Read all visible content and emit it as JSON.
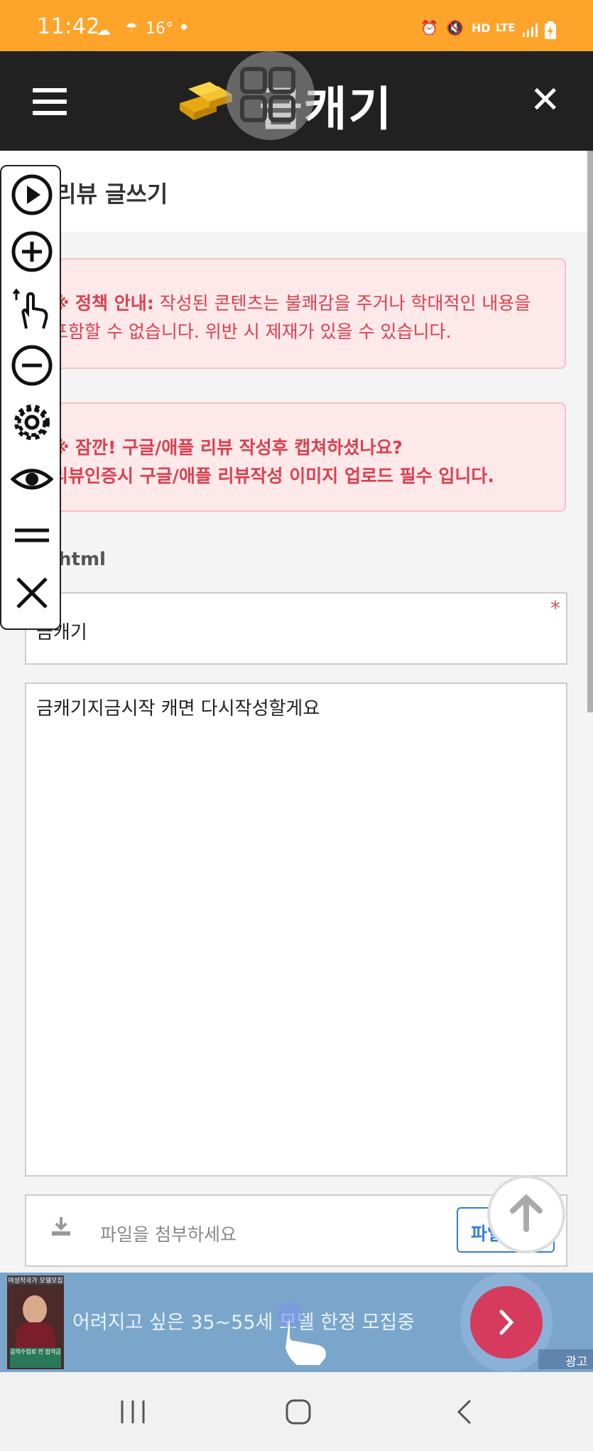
{
  "status_bar": {
    "time": "11:42",
    "temperature": "16°",
    "icons": [
      "cloud-icon",
      "weather-icon",
      "dot-icon",
      "alarm-icon",
      "mute-icon",
      "hd-voice-icon",
      "lte-icon",
      "signal-icon",
      "battery-charging-icon"
    ],
    "hd_label": "HD",
    "lte_label": "LTE"
  },
  "app_bar": {
    "menu_icon": "hamburger-icon",
    "title": "금캐기",
    "close_icon": "close-icon"
  },
  "page": {
    "back_icon": "chevron-left-icon",
    "title": "리뷰 글쓰기"
  },
  "notices": {
    "policy_prefix": "※ 정책 안내:",
    "policy_text_line1": " 작성된 콘텐츠는 불쾌감을 주거나 학대적인 내용을",
    "policy_text_line2": "포함할 수 없습니다. 위반 시 제재가 있을 수 있습니다.",
    "review_line1": "※ 잠깐! 구글/애플 리뷰 작성후 캡쳐하셨나요?",
    "review_line2": "리뷰인증시 구글/애플 리뷰작성 이미지 업로드 필수 입니다."
  },
  "form": {
    "html_checkbox_label": "html",
    "html_checked": false,
    "subject_value": "금캐기",
    "required_mark": "*",
    "content_value": "금캐기지금시작 캐면 다시작성할게요",
    "file_placeholder": "파일을 첨부하세요",
    "file_button_label": "파일"
  },
  "floating_toolbar": {
    "items": [
      "play-icon",
      "zoom-in-icon",
      "touch-icon",
      "zoom-out-icon",
      "settings-icon",
      "eye-icon",
      "equals-icon",
      "close-icon"
    ]
  },
  "scroll_top_icon": "arrow-up-icon",
  "ad": {
    "thumb_caption": "여성작곡가 모델모집",
    "thumb_sign": "음악수업료 전 합격금",
    "text": "어려지고 싶은 35~55세 모델 한정 모집중",
    "next_icon": "chevron-right-icon",
    "label": "광고"
  },
  "nav_bar": {
    "items": [
      "recent-apps-icon",
      "home-icon",
      "back-icon"
    ]
  },
  "colors": {
    "status_bar": "#ffa42b",
    "app_bar": "#212121",
    "notice_bg": "#fde8ea",
    "notice_text": "#d8414f",
    "accent_blue": "#2f7fd8",
    "ad_bg": "#7aa6cc",
    "ad_button": "#d63a5c"
  }
}
